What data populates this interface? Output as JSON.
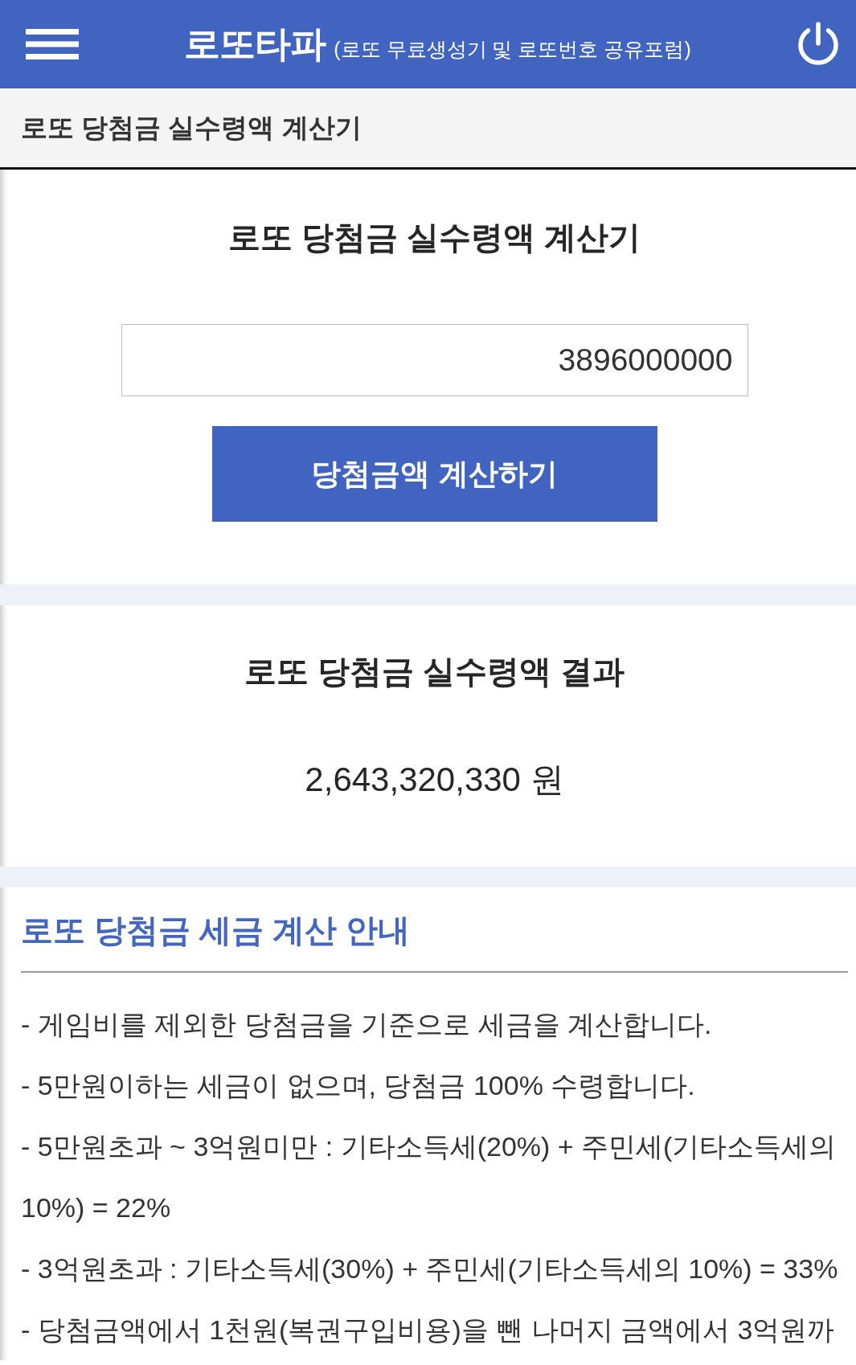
{
  "header": {
    "title": "로또타파",
    "subtitle": "(로또 무료생성기 및 로또번호 공유포럼)"
  },
  "page_title": "로또 당첨금 실수령액 계산기",
  "calculator": {
    "title": "로또 당첨금 실수령액 계산기",
    "amount_input": {
      "value": "3896000000"
    },
    "button": "당첨금액 계산하기"
  },
  "result": {
    "title": "로또 당첨금 실수령액 결과",
    "amount": "2,643,320,330 원"
  },
  "tax_info": {
    "title": "로또 당첨금 세금 계산 안내",
    "lines": [
      "- 게임비를 제외한 당첨금을 기준으로 세금을 계산합니다.",
      "- 5만원이하는 세금이 없으며, 당첨금 100% 수령합니다.",
      "- 5만원초과 ~ 3억원미만 : 기타소득세(20%) + 주민세(기타소득세의 10%) = 22%",
      "- 3억원초과 : 기타소득세(30%) + 주민세(기타소득세의 10%) = 33%",
      "- 당첨금액에서 1천원(복권구입비용)을 뺀 나머지 금액에서 3억원까"
    ]
  }
}
